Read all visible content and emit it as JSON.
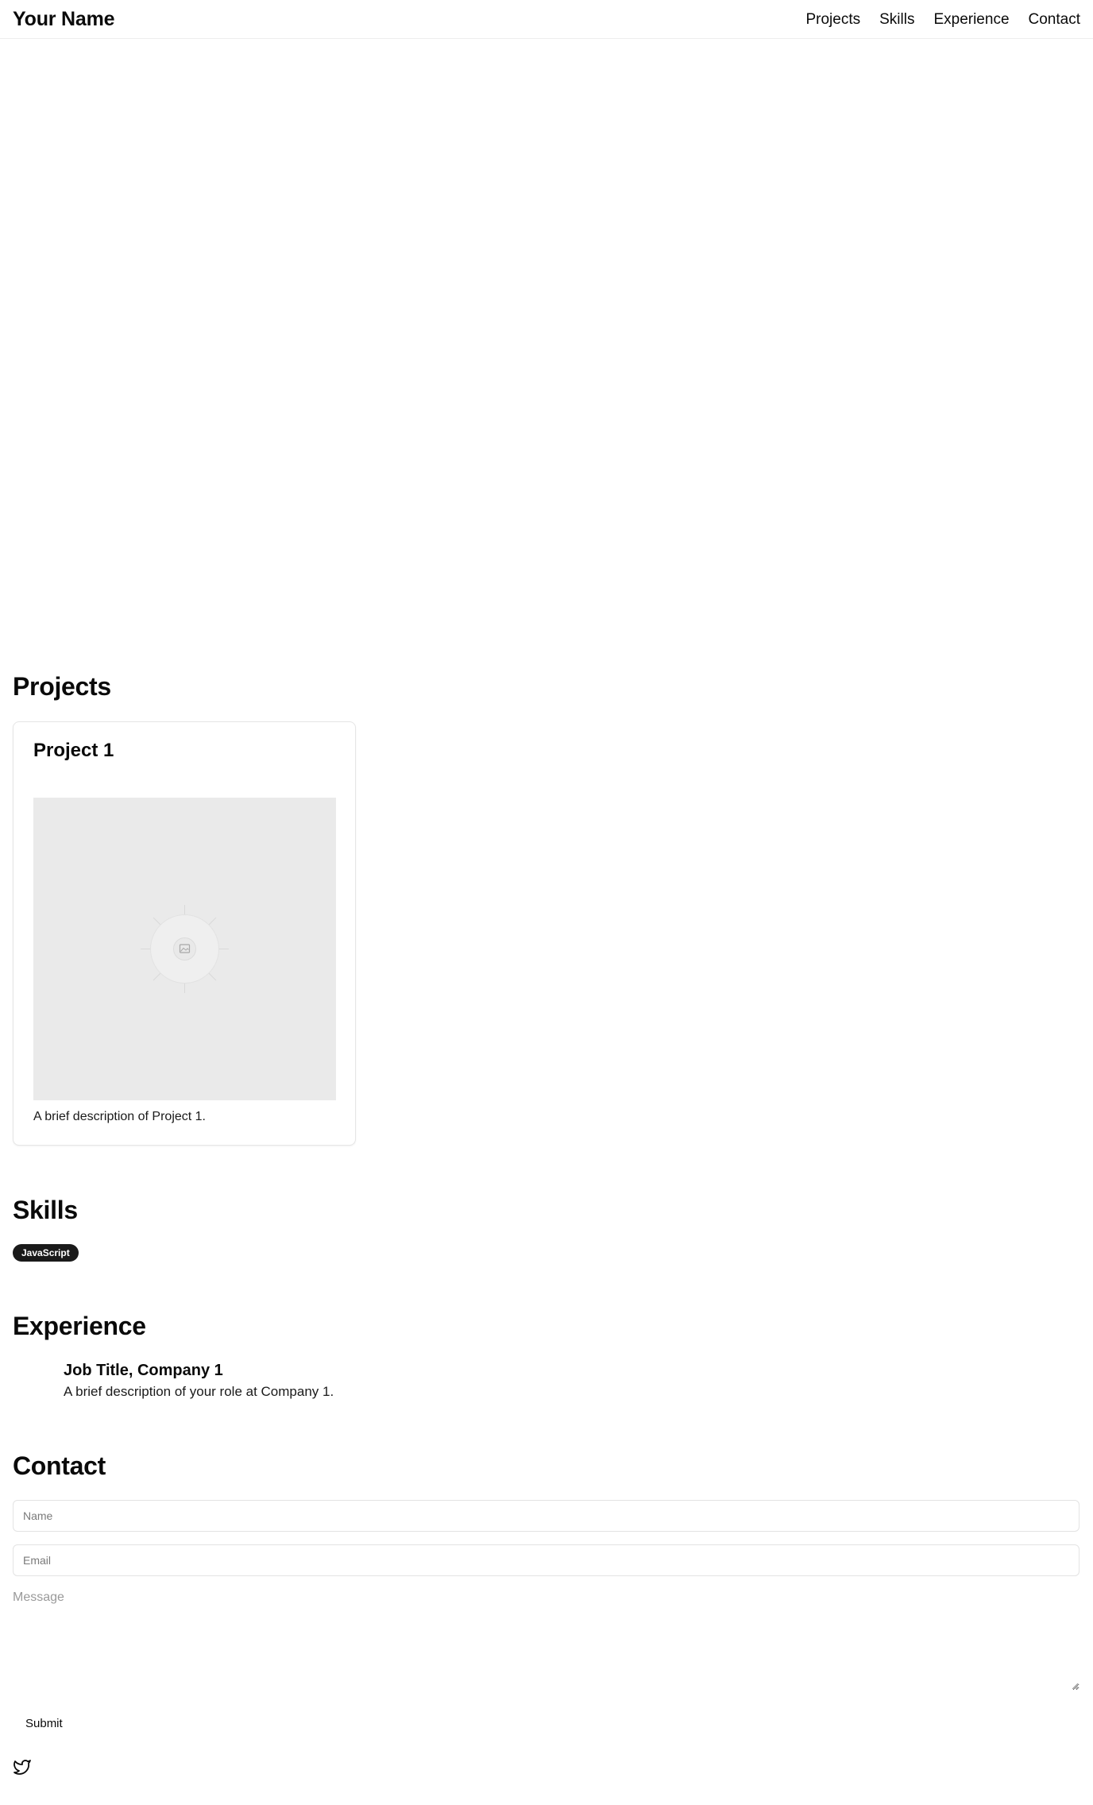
{
  "header": {
    "brand": "Your Name",
    "nav": [
      "Projects",
      "Skills",
      "Experience",
      "Contact"
    ]
  },
  "projects": {
    "heading": "Projects",
    "items": [
      {
        "title": "Project 1",
        "image_icon": "image-placeholder-icon",
        "description": "A brief description of Project 1."
      }
    ]
  },
  "skills": {
    "heading": "Skills",
    "items": [
      "JavaScript"
    ]
  },
  "experience": {
    "heading": "Experience",
    "items": [
      {
        "title": "Job Title, Company 1",
        "description": "A brief description of your role at Company 1."
      }
    ]
  },
  "contact": {
    "heading": "Contact",
    "name_placeholder": "Name",
    "email_placeholder": "Email",
    "message_placeholder": "Message",
    "submit_label": "Submit",
    "social_icon": "twitter-icon"
  },
  "colors": {
    "text": "#0a0a0a",
    "badge_bg": "#1a1a1a",
    "placeholder_bg": "#eaeaea",
    "border": "#e5e5e5"
  }
}
